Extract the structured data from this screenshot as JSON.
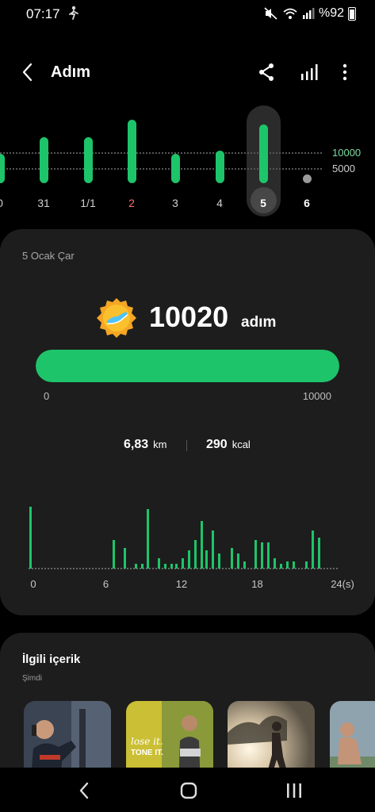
{
  "status_bar": {
    "time": "07:17",
    "battery_text": "%92",
    "icons": [
      "walking-person-icon",
      "mute-icon",
      "wifi-icon",
      "signal-icon",
      "battery-icon"
    ]
  },
  "header": {
    "title": "Adım",
    "icons": [
      "back-arrow-icon",
      "share-icon",
      "stats-icon",
      "more-vert-icon"
    ]
  },
  "week_strip": {
    "goal_high_label": "10000",
    "goal_low_label": "5000",
    "days": [
      {
        "label": "0",
        "steps": 5000,
        "highlight": false
      },
      {
        "label": "31",
        "steps": 7800,
        "highlight": false
      },
      {
        "label": "1/1",
        "steps": 7800,
        "highlight": false
      },
      {
        "label": "2",
        "steps": 10800,
        "highlight": true
      },
      {
        "label": "3",
        "steps": 5000,
        "highlight": false
      },
      {
        "label": "4",
        "steps": 5600,
        "highlight": false
      },
      {
        "label": "5",
        "steps": 10020,
        "highlight": false,
        "selected": true
      },
      {
        "label": "6",
        "steps": 0,
        "highlight": false
      }
    ],
    "colors": {
      "bar": "#1ec46a",
      "goal_label": "#7fd9a0",
      "highlight_label": "#ff6b6b"
    }
  },
  "day_card": {
    "date": "5 Ocak Çar",
    "steps": "10020",
    "steps_unit": "adım",
    "goal": 10000,
    "progress_fraction": 1.0,
    "progress_min": "0",
    "progress_max": "10000",
    "distance_value": "6,83",
    "distance_unit": "km",
    "calories_value": "290",
    "calories_unit": "kcal",
    "hourly_ticks": [
      "0",
      "6",
      "12",
      "18",
      "24(s)"
    ],
    "hourly_values": [
      {
        "h": 0,
        "v": 100
      },
      {
        "h": 6.6,
        "v": 46
      },
      {
        "h": 7.5,
        "v": 33
      },
      {
        "h": 8.4,
        "v": 8
      },
      {
        "h": 8.9,
        "v": 8
      },
      {
        "h": 9.3,
        "v": 96
      },
      {
        "h": 10.2,
        "v": 17
      },
      {
        "h": 10.7,
        "v": 8
      },
      {
        "h": 11.2,
        "v": 8
      },
      {
        "h": 11.6,
        "v": 8
      },
      {
        "h": 12.1,
        "v": 17
      },
      {
        "h": 12.6,
        "v": 29
      },
      {
        "h": 13.1,
        "v": 46
      },
      {
        "h": 13.6,
        "v": 77
      },
      {
        "h": 14.0,
        "v": 29
      },
      {
        "h": 14.5,
        "v": 61
      },
      {
        "h": 15.0,
        "v": 25
      },
      {
        "h": 16.0,
        "v": 33
      },
      {
        "h": 16.5,
        "v": 25
      },
      {
        "h": 17.0,
        "v": 12
      },
      {
        "h": 17.9,
        "v": 46
      },
      {
        "h": 18.4,
        "v": 42
      },
      {
        "h": 18.9,
        "v": 42
      },
      {
        "h": 19.4,
        "v": 17
      },
      {
        "h": 19.9,
        "v": 8
      },
      {
        "h": 20.4,
        "v": 12
      },
      {
        "h": 20.9,
        "v": 12
      },
      {
        "h": 21.9,
        "v": 12
      },
      {
        "h": 22.4,
        "v": 61
      },
      {
        "h": 22.9,
        "v": 50
      }
    ]
  },
  "related": {
    "title": "İlgili içerik",
    "subtitle": "Şimdi",
    "thumbnails": [
      {
        "name": "workout-photo-1"
      },
      {
        "name": "workout-photo-2",
        "text_line1": "lose it.",
        "text_line2": "TONE IT."
      },
      {
        "name": "running-photo"
      },
      {
        "name": "workout-photo-4"
      }
    ]
  },
  "nav_bar": {
    "icons": [
      "back-nav-icon",
      "home-nav-icon",
      "recents-nav-icon"
    ]
  }
}
